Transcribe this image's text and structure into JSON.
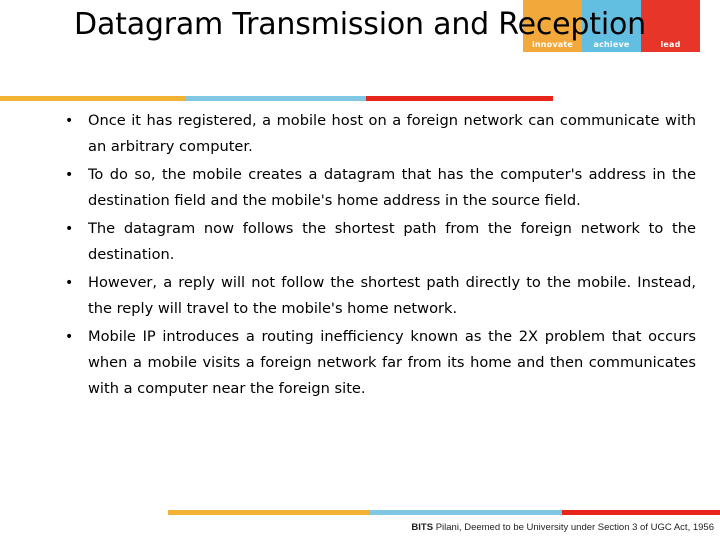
{
  "slide": {
    "title": "Datagram Transmission and Reception",
    "bullets": [
      "Once it has   registered, a mobile host on a   foreign network can communicate with an  arbitrary computer.",
      "To do so, the mobile creates a datagram that has  the computer's address in  the destination field and the mobile's  home address in  the source field.",
      "The datagram now follows the shortest path from the foreign network to the destination.",
      "However, a  reply  will  not  follow  the  shortest path  directly  to  the  mobile. Instead,  the  reply will  travel  to  the  mobile's  home  network.",
      "Mobile  IP  introduces a  routing  inefficiency known as  the 2X problem that  occurs when a mobile  visits a foreign  network  far from  its home and  then  communicates with  a  computer near  the foreign  site."
    ]
  },
  "logo": {
    "segments": [
      {
        "word": "innovate",
        "color": "#f2a83b"
      },
      {
        "word": "achieve",
        "color": "#63bfe2"
      },
      {
        "word": "lead",
        "color": "#e8352a"
      }
    ]
  },
  "rule_top": {
    "colors": [
      "#f2b233",
      "#7fc7e3",
      "#e8251b"
    ]
  },
  "rule_bottom": {
    "colors": [
      "#f2b233",
      "#7fc7e3",
      "#e8251b"
    ]
  },
  "footer": {
    "brand": "BITS",
    "text": " Pilani, Deemed to be University under Section 3 of UGC Act, 1956"
  }
}
